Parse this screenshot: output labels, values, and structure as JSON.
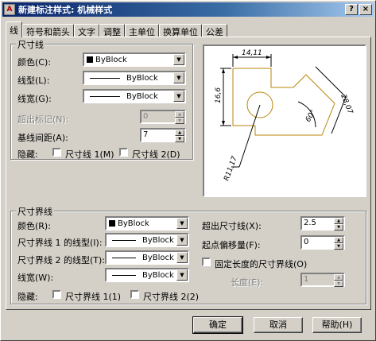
{
  "window": {
    "title": "新建标注样式: 机械样式",
    "help_button": "?",
    "close_button": "×"
  },
  "tabs": [
    "线",
    "符号和箭头",
    "文字",
    "调整",
    "主单位",
    "换算单位",
    "公差"
  ],
  "dim_lines": {
    "group_label": "尺寸线",
    "color_label": "颜色(C):",
    "color_value": "ByBlock",
    "linetype_label": "线型(L):",
    "linetype_value": "ByBlock",
    "lineweight_label": "线宽(G):",
    "lineweight_value": "ByBlock",
    "extend_label": "超出标记(N):",
    "extend_value": "0",
    "baseline_label": "基线间距(A):",
    "baseline_value": "7",
    "suppress_label": "隐藏:",
    "suppress_1": "尺寸线 1(M)",
    "suppress_2": "尺寸线 2(D)"
  },
  "ext_lines": {
    "group_label": "尺寸界线",
    "color_label": "颜色(R):",
    "color_value": "ByBlock",
    "linetype1_label": "尺寸界线 1 的线型(I):",
    "linetype1_value": "ByBlock",
    "linetype2_label": "尺寸界线 2 的线型(T):",
    "linetype2_value": "ByBlock",
    "lineweight_label": "线宽(W):",
    "lineweight_value": "ByBlock",
    "suppress_label": "隐藏:",
    "suppress_1": "尺寸界线 1(1)",
    "suppress_2": "尺寸界线 2(2)",
    "extend_label": "超出尺寸线(X):",
    "extend_value": "2.5",
    "offset_label": "起点偏移量(F):",
    "offset_value": "0",
    "fixed_label": "固定长度的尺寸界线(O)",
    "length_label": "长度(E):",
    "length_value": "1"
  },
  "preview": {
    "dim_top": "14,11",
    "dim_left": "16,6",
    "dim_right": "28,07",
    "dim_angle": "60°",
    "dim_radius": "R11,17"
  },
  "buttons": {
    "ok": "确定",
    "cancel": "取消",
    "help": "帮助(H)"
  }
}
